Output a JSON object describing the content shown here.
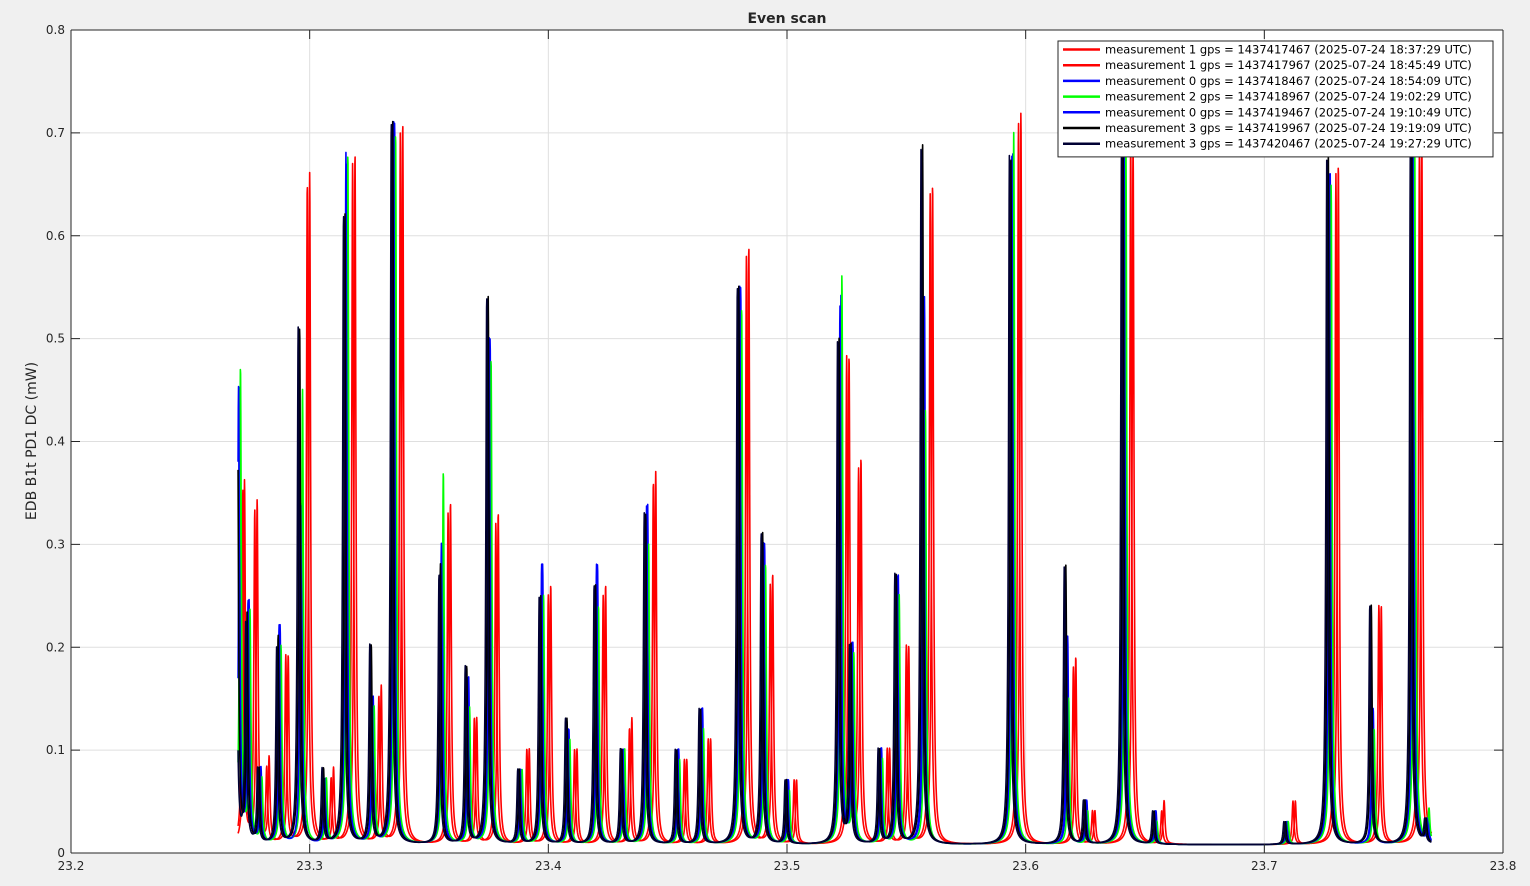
{
  "chart_data": {
    "type": "line",
    "title": "Even scan",
    "xlabel": "",
    "ylabel": "EDB B1t PD1 DC (mW)",
    "xlim": [
      23.2,
      23.8
    ],
    "ylim": [
      0,
      0.8
    ],
    "xticks": [
      23.2,
      23.3,
      23.4,
      23.5,
      23.6,
      23.7,
      23.8
    ],
    "yticks": [
      0,
      0.1,
      0.2,
      0.3,
      0.4,
      0.5,
      0.6,
      0.7,
      0.8
    ],
    "xtick_labels": [
      "23.2",
      "23.3",
      "23.4",
      "23.5",
      "23.6",
      "23.7",
      "23.8"
    ],
    "ytick_labels": [
      "0",
      "0.1",
      "0.2",
      "0.3",
      "0.4",
      "0.5",
      "0.6",
      "0.7",
      "0.8"
    ],
    "grid": true,
    "legend_position": "top-right",
    "x_range": [
      23.27,
      23.77
    ],
    "baseline": 0.008,
    "series": [
      {
        "name": "measurement 1 gps = 1437417467 (2025-07-24 18:37:29 UTC)",
        "color": "#ff0000",
        "shift": 0.0025,
        "peaks": [
          [
            23.2702,
            0.36
          ],
          [
            23.2755,
            0.34
          ],
          [
            23.2805,
            0.09
          ],
          [
            23.2885,
            0.19
          ],
          [
            23.2975,
            0.66
          ],
          [
            23.3075,
            0.08
          ],
          [
            23.3165,
            0.68
          ],
          [
            23.3275,
            0.16
          ],
          [
            23.3365,
            0.71
          ],
          [
            23.3565,
            0.34
          ],
          [
            23.3675,
            0.13
          ],
          [
            23.3765,
            0.33
          ],
          [
            23.3895,
            0.1
          ],
          [
            23.3985,
            0.26
          ],
          [
            23.4095,
            0.1
          ],
          [
            23.4215,
            0.26
          ],
          [
            23.4325,
            0.13
          ],
          [
            23.4425,
            0.37
          ],
          [
            23.4555,
            0.09
          ],
          [
            23.4655,
            0.11
          ],
          [
            23.4815,
            0.59
          ],
          [
            23.4915,
            0.27
          ],
          [
            23.5015,
            0.07
          ],
          [
            23.5235,
            0.48
          ],
          [
            23.5285,
            0.38
          ],
          [
            23.5405,
            0.1
          ],
          [
            23.5485,
            0.2
          ],
          [
            23.5585,
            0.65
          ],
          [
            23.5955,
            0.72
          ],
          [
            23.6185,
            0.19
          ],
          [
            23.6265,
            0.04
          ],
          [
            23.6425,
            0.69
          ],
          [
            23.6555,
            0.05
          ],
          [
            23.7105,
            0.05
          ],
          [
            23.7285,
            0.67
          ],
          [
            23.7465,
            0.24
          ],
          [
            23.7635,
            0.69
          ],
          [
            23.7695,
            0.06
          ]
        ]
      },
      {
        "name": "measurement 1 gps = 1437417967 (2025-07-24 18:45:49 UTC)",
        "color": "#ff0000",
        "shift": 0.0018,
        "peaks": [
          [
            23.2702,
            0.35
          ],
          [
            23.2752,
            0.33
          ],
          [
            23.2802,
            0.08
          ],
          [
            23.2882,
            0.19
          ],
          [
            23.2972,
            0.65
          ],
          [
            23.3072,
            0.07
          ],
          [
            23.3162,
            0.67
          ],
          [
            23.3272,
            0.15
          ],
          [
            23.3362,
            0.7
          ],
          [
            23.3562,
            0.33
          ],
          [
            23.3672,
            0.13
          ],
          [
            23.3762,
            0.32
          ],
          [
            23.3892,
            0.1
          ],
          [
            23.3982,
            0.25
          ],
          [
            23.4092,
            0.1
          ],
          [
            23.4212,
            0.25
          ],
          [
            23.4322,
            0.12
          ],
          [
            23.4422,
            0.36
          ],
          [
            23.4552,
            0.09
          ],
          [
            23.4652,
            0.11
          ],
          [
            23.4812,
            0.58
          ],
          [
            23.4912,
            0.26
          ],
          [
            23.5012,
            0.07
          ],
          [
            23.5232,
            0.48
          ],
          [
            23.5282,
            0.37
          ],
          [
            23.5402,
            0.1
          ],
          [
            23.5482,
            0.2
          ],
          [
            23.5582,
            0.64
          ],
          [
            23.5952,
            0.71
          ],
          [
            23.6182,
            0.18
          ],
          [
            23.6262,
            0.04
          ],
          [
            23.6422,
            0.69
          ],
          [
            23.6552,
            0.04
          ],
          [
            23.7102,
            0.05
          ],
          [
            23.7282,
            0.66
          ],
          [
            23.7462,
            0.24
          ],
          [
            23.7632,
            0.69
          ],
          [
            23.7692,
            0.05
          ]
        ]
      },
      {
        "name": "measurement 0 gps = 1437418467 (2025-07-24 18:54:09 UTC)",
        "color": "#0000ff",
        "shift": 0.0004,
        "peaks": [
          [
            23.2702,
            0.45
          ],
          [
            23.2742,
            0.24
          ],
          [
            23.2792,
            0.08
          ],
          [
            23.2872,
            0.22
          ],
          [
            23.2962,
            0.34
          ],
          [
            23.3062,
            0.07
          ],
          [
            23.3152,
            0.67
          ],
          [
            23.3262,
            0.15
          ],
          [
            23.3352,
            0.71
          ],
          [
            23.3552,
            0.3
          ],
          [
            23.3662,
            0.17
          ],
          [
            23.3752,
            0.5
          ],
          [
            23.3882,
            0.08
          ],
          [
            23.3972,
            0.28
          ],
          [
            23.4082,
            0.12
          ],
          [
            23.4202,
            0.28
          ],
          [
            23.4312,
            0.1
          ],
          [
            23.4412,
            0.34
          ],
          [
            23.4542,
            0.1
          ],
          [
            23.4642,
            0.14
          ],
          [
            23.4802,
            0.55
          ],
          [
            23.4902,
            0.3
          ],
          [
            23.5002,
            0.07
          ],
          [
            23.5222,
            0.54
          ],
          [
            23.5272,
            0.2
          ],
          [
            23.5392,
            0.1
          ],
          [
            23.5462,
            0.27
          ],
          [
            23.5572,
            0.54
          ],
          [
            23.5942,
            0.68
          ],
          [
            23.6172,
            0.21
          ],
          [
            23.6252,
            0.05
          ],
          [
            23.6412,
            0.7
          ],
          [
            23.6542,
            0.04
          ],
          [
            23.7092,
            0.03
          ],
          [
            23.7272,
            0.66
          ],
          [
            23.7452,
            0.14
          ],
          [
            23.7622,
            0.69
          ],
          [
            23.7682,
            0.03
          ]
        ]
      },
      {
        "name": "measurement 2 gps = 1437418967 (2025-07-24 19:02:29 UTC)",
        "color": "#00ff00",
        "shift": 0.0008,
        "peaks": [
          [
            23.2702,
            0.47
          ],
          [
            23.2742,
            0.23
          ],
          [
            23.2792,
            0.07
          ],
          [
            23.2872,
            0.2
          ],
          [
            23.2962,
            0.45
          ],
          [
            23.3062,
            0.07
          ],
          [
            23.3152,
            0.68
          ],
          [
            23.3262,
            0.14
          ],
          [
            23.3352,
            0.7
          ],
          [
            23.3552,
            0.37
          ],
          [
            23.3662,
            0.14
          ],
          [
            23.3752,
            0.48
          ],
          [
            23.3882,
            0.08
          ],
          [
            23.3972,
            0.25
          ],
          [
            23.4082,
            0.11
          ],
          [
            23.4202,
            0.24
          ],
          [
            23.4312,
            0.1
          ],
          [
            23.4412,
            0.3
          ],
          [
            23.4542,
            0.09
          ],
          [
            23.4642,
            0.12
          ],
          [
            23.4802,
            0.53
          ],
          [
            23.4902,
            0.28
          ],
          [
            23.5002,
            0.06
          ],
          [
            23.5222,
            0.56
          ],
          [
            23.5272,
            0.19
          ],
          [
            23.5392,
            0.09
          ],
          [
            23.5462,
            0.25
          ],
          [
            23.5572,
            0.43
          ],
          [
            23.5942,
            0.7
          ],
          [
            23.6172,
            0.15
          ],
          [
            23.6252,
            0.04
          ],
          [
            23.6412,
            0.69
          ],
          [
            23.6542,
            0.03
          ],
          [
            23.7092,
            0.03
          ],
          [
            23.7272,
            0.65
          ],
          [
            23.7452,
            0.12
          ],
          [
            23.7622,
            0.69
          ],
          [
            23.7682,
            0.04
          ]
        ]
      },
      {
        "name": "measurement 0 gps = 1437419467 (2025-07-24 19:10:49 UTC)",
        "color": "#0000ff",
        "shift": 0.0,
        "peaks": [
          [
            23.2702,
            0.45
          ],
          [
            23.2742,
            0.24
          ],
          [
            23.2792,
            0.08
          ],
          [
            23.2872,
            0.22
          ],
          [
            23.2962,
            0.34
          ],
          [
            23.3062,
            0.07
          ],
          [
            23.3152,
            0.68
          ],
          [
            23.3262,
            0.15
          ],
          [
            23.3352,
            0.71
          ],
          [
            23.3552,
            0.3
          ],
          [
            23.3662,
            0.17
          ],
          [
            23.3752,
            0.5
          ],
          [
            23.3882,
            0.08
          ],
          [
            23.3972,
            0.28
          ],
          [
            23.4082,
            0.12
          ],
          [
            23.4202,
            0.28
          ],
          [
            23.4312,
            0.1
          ],
          [
            23.4412,
            0.34
          ],
          [
            23.4542,
            0.1
          ],
          [
            23.4642,
            0.14
          ],
          [
            23.4802,
            0.55
          ],
          [
            23.4902,
            0.3
          ],
          [
            23.5002,
            0.07
          ],
          [
            23.5222,
            0.53
          ],
          [
            23.5272,
            0.2
          ],
          [
            23.5392,
            0.1
          ],
          [
            23.5462,
            0.27
          ],
          [
            23.5572,
            0.54
          ],
          [
            23.5942,
            0.68
          ],
          [
            23.6172,
            0.21
          ],
          [
            23.6252,
            0.05
          ],
          [
            23.6412,
            0.7
          ],
          [
            23.6542,
            0.04
          ],
          [
            23.7092,
            0.03
          ],
          [
            23.7272,
            0.66
          ],
          [
            23.7452,
            0.14
          ],
          [
            23.7622,
            0.69
          ],
          [
            23.7682,
            0.03
          ]
        ]
      },
      {
        "name": "measurement 3 gps = 1437419967 (2025-07-24 19:19:09 UTC)",
        "color": "#000000",
        "shift": -0.0004,
        "peaks": [
          [
            23.2702,
            0.44
          ],
          [
            23.2742,
            0.23
          ],
          [
            23.2792,
            0.08
          ],
          [
            23.2872,
            0.21
          ],
          [
            23.2962,
            0.51
          ],
          [
            23.3062,
            0.08
          ],
          [
            23.3152,
            0.62
          ],
          [
            23.3262,
            0.2
          ],
          [
            23.3352,
            0.71
          ],
          [
            23.3552,
            0.28
          ],
          [
            23.3662,
            0.18
          ],
          [
            23.3752,
            0.54
          ],
          [
            23.3882,
            0.08
          ],
          [
            23.3972,
            0.25
          ],
          [
            23.4082,
            0.13
          ],
          [
            23.4202,
            0.26
          ],
          [
            23.4312,
            0.1
          ],
          [
            23.4412,
            0.33
          ],
          [
            23.4542,
            0.1
          ],
          [
            23.4642,
            0.14
          ],
          [
            23.4802,
            0.55
          ],
          [
            23.4902,
            0.31
          ],
          [
            23.5002,
            0.07
          ],
          [
            23.5222,
            0.5
          ],
          [
            23.5272,
            0.2
          ],
          [
            23.5392,
            0.1
          ],
          [
            23.5462,
            0.27
          ],
          [
            23.5572,
            0.69
          ],
          [
            23.5942,
            0.68
          ],
          [
            23.6172,
            0.28
          ],
          [
            23.6252,
            0.05
          ],
          [
            23.6412,
            0.7
          ],
          [
            23.6542,
            0.04
          ],
          [
            23.7092,
            0.03
          ],
          [
            23.7272,
            0.68
          ],
          [
            23.7452,
            0.24
          ],
          [
            23.7622,
            0.69
          ],
          [
            23.7682,
            0.03
          ]
        ]
      },
      {
        "name": "measurement 3 gps = 1437420467 (2025-07-24 19:27:29 UTC)",
        "color": "#000033",
        "shift": -0.001,
        "peaks": [
          [
            23.2702,
            0.37
          ],
          [
            23.2742,
            0.22
          ],
          [
            23.2792,
            0.08
          ],
          [
            23.2872,
            0.2
          ],
          [
            23.2962,
            0.51
          ],
          [
            23.3062,
            0.08
          ],
          [
            23.3152,
            0.62
          ],
          [
            23.3262,
            0.2
          ],
          [
            23.3352,
            0.71
          ],
          [
            23.3552,
            0.27
          ],
          [
            23.3662,
            0.18
          ],
          [
            23.3752,
            0.54
          ],
          [
            23.3882,
            0.08
          ],
          [
            23.3972,
            0.25
          ],
          [
            23.4082,
            0.13
          ],
          [
            23.4202,
            0.26
          ],
          [
            23.4312,
            0.1
          ],
          [
            23.4412,
            0.33
          ],
          [
            23.4542,
            0.1
          ],
          [
            23.4642,
            0.14
          ],
          [
            23.4802,
            0.55
          ],
          [
            23.4902,
            0.31
          ],
          [
            23.5002,
            0.07
          ],
          [
            23.5222,
            0.5
          ],
          [
            23.5272,
            0.2
          ],
          [
            23.5392,
            0.1
          ],
          [
            23.5462,
            0.27
          ],
          [
            23.5572,
            0.69
          ],
          [
            23.5942,
            0.68
          ],
          [
            23.6172,
            0.28
          ],
          [
            23.6252,
            0.05
          ],
          [
            23.6412,
            0.7
          ],
          [
            23.6542,
            0.04
          ],
          [
            23.7092,
            0.03
          ],
          [
            23.7272,
            0.68
          ],
          [
            23.7452,
            0.24
          ],
          [
            23.7622,
            0.69
          ],
          [
            23.7682,
            0.03
          ]
        ]
      }
    ]
  }
}
